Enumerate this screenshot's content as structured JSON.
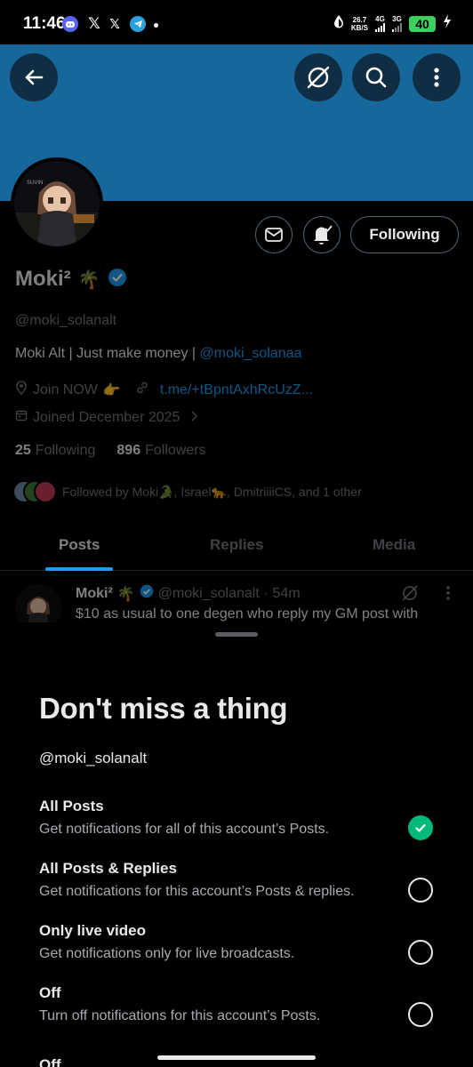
{
  "status_bar": {
    "time": "11:46",
    "speed_value": "26.7",
    "speed_unit": "KB/S",
    "net1": "4G",
    "net2": "3G",
    "battery": "40",
    "apps": [
      "discord-icon",
      "x-icon",
      "x-icon",
      "telegram-icon"
    ]
  },
  "profile": {
    "name": "Moki²",
    "name_emoji": "🌴",
    "handle": "@moki_solanalt",
    "bio_text": "Moki Alt | Just make money | ",
    "bio_link": "@moki_solanaa",
    "location": "Join NOW",
    "location_emoji": "👉",
    "website": "t.me/+tBpntAxhRcUzZ...",
    "joined": "Joined December 2025",
    "following_count": "25",
    "following_label": "Following",
    "followers_count": "896",
    "followers_label": "Followers",
    "followed_by": "Followed by Moki🐊, Israel🐆, DmitriiiiCS, and 1 other",
    "follow_button": "Following"
  },
  "tabs": [
    "Posts",
    "Replies",
    "Media"
  ],
  "active_tab": "Posts",
  "post": {
    "name": "Moki²",
    "emoji": "🌴",
    "handle": "@moki_solanalt",
    "time": "· 54m",
    "text": "$10 as usual to one degen who reply my GM post with"
  },
  "sheet": {
    "title": "Don't miss a thing",
    "handle": "@moki_solanalt",
    "options": [
      {
        "title": "All Posts",
        "desc": "Get notifications for all of this account’s Posts.",
        "selected": true
      },
      {
        "title": "All Posts & Replies",
        "desc": "Get notifications for this account’s Posts & replies.",
        "selected": false
      },
      {
        "title": "Only live video",
        "desc": "Get notifications only for live broadcasts.",
        "selected": false
      },
      {
        "title": "Off",
        "desc": "Turn off notifications for this account’s Posts.",
        "selected": false
      }
    ],
    "partial_next": "Off"
  },
  "colors": {
    "banner": "#16679b",
    "accent": "#1d9bf0",
    "selected": "#00ba7c",
    "battery": "#3ecf5e"
  }
}
